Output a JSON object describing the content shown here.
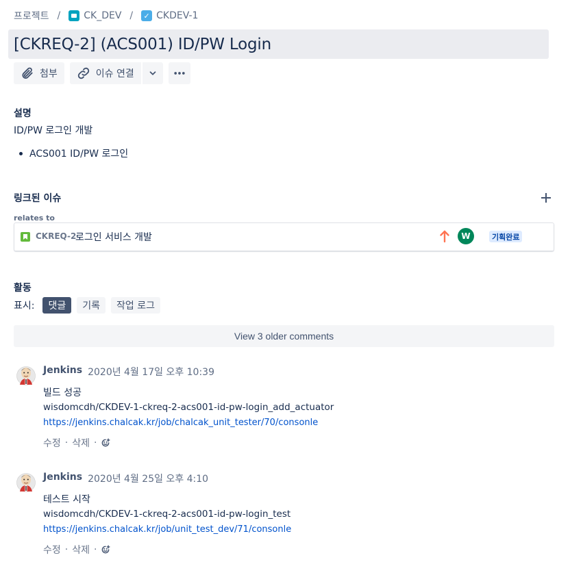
{
  "breadcrumb": {
    "items": [
      {
        "label": "프로젝트"
      },
      {
        "label": "CK_DEV"
      },
      {
        "label": "CKDEV-1"
      }
    ],
    "separator": "/"
  },
  "issue": {
    "title": "[CKREQ-2] (ACS001) ID/PW Login"
  },
  "toolbar": {
    "attach_label": "첨부",
    "link_label": "이슈 연결"
  },
  "description": {
    "heading": "설명",
    "text": "ID/PW 로그인 개발",
    "bullets": [
      "ACS001 ID/PW 로그인"
    ]
  },
  "linked_issues": {
    "heading": "링크된 이슈",
    "relation": "relates to",
    "items": [
      {
        "key": "CKREQ-2",
        "summary": "로그인 서비스 개발",
        "assignee_initial": "W",
        "status": "기획완료",
        "priority": "high"
      }
    ]
  },
  "activity": {
    "heading": "활동",
    "show_label": "표시:",
    "filters": [
      {
        "label": "댓글",
        "active": true
      },
      {
        "label": "기록",
        "active": false
      },
      {
        "label": "작업 로그",
        "active": false
      }
    ],
    "older_comments_label": "View 3 older comments",
    "comments": [
      {
        "author": "Jenkins",
        "time": "2020년 4월 17일 오후 10:39",
        "lines": [
          "빌드 성공",
          "wisdomcdh/CKDEV-1-ckreq-2-acs001-id-pw-login_add_actuator"
        ],
        "link": "https://jenkins.chalcak.kr/job/chalcak_unit_tester/70/consonle",
        "actions": {
          "edit": "수정",
          "delete": "삭제",
          "dot": "·"
        }
      },
      {
        "author": "Jenkins",
        "time": "2020년 4월 25일 오후 4:10",
        "lines": [
          "테스트 시작",
          "wisdomcdh/CKDEV-1-ckreq-2-acs001-id-pw-login_test"
        ],
        "link": "https://jenkins.chalcak.kr/job/unit_test_dev/71/consonle",
        "actions": {
          "edit": "수정",
          "delete": "삭제",
          "dot": "·"
        }
      }
    ]
  },
  "colors": {
    "accent": "#0052cc",
    "title_bg": "#ebecf0",
    "lozenge_bg": "#deebff",
    "lozenge_text": "#0747a6",
    "avatar_w": "#00875a",
    "priority_high": "#ff7452"
  }
}
